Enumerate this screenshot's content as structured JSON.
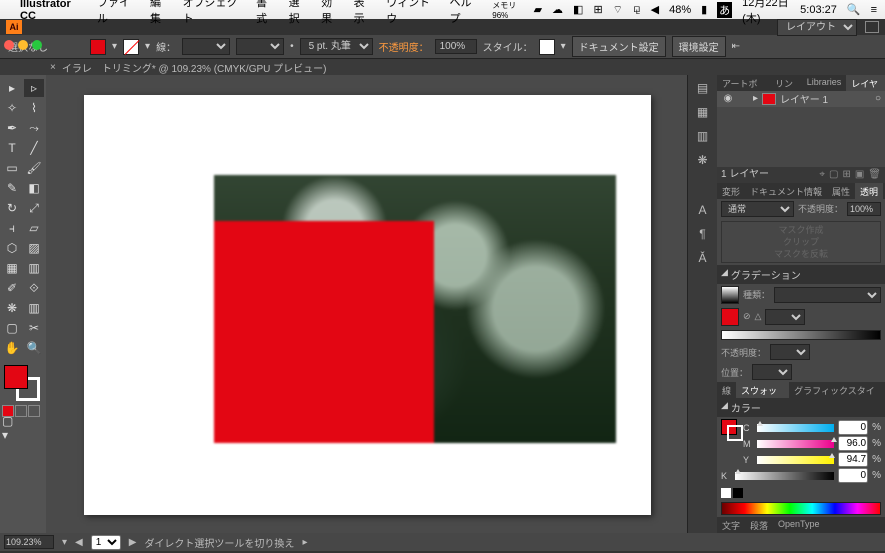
{
  "menubar": {
    "app": "Illustrator CC",
    "items": [
      "ファイル",
      "編集",
      "オブジェクト",
      "書式",
      "選択",
      "効果",
      "表示",
      "ウィンドウ",
      "ヘルプ"
    ],
    "right": {
      "mem": "メモリ 96%",
      "battery": "48%",
      "date": "12月22日(木)",
      "time": "5:03:27"
    }
  },
  "appbar": {
    "layout": "レイアウト"
  },
  "control": {
    "selection": "選択なし",
    "stroke": "線：",
    "strokeUnit": "5 pt. 丸筆",
    "opacity_label": "不透明度：",
    "opacity": "100%",
    "style": "スタイル：",
    "docsetup": "ドキュメント設定",
    "prefs": "環境設定"
  },
  "tab": {
    "close": "×",
    "title": "イラレ　トリミング* @ 109.23% (CMYK/GPU プレビュー)"
  },
  "layers": {
    "tabs": [
      "アートボード",
      "リンク",
      "Libraries",
      "レイヤー"
    ],
    "row": "レイヤー 1",
    "status": "1 レイヤー"
  },
  "appearance": {
    "tabs": [
      "変形",
      "ドキュメント情報",
      "属性",
      "透明"
    ],
    "blend": "通常",
    "op_label": "不透明度：",
    "op": "100%",
    "mask": [
      "マスク作成",
      "クリップ",
      "マスクを反転"
    ]
  },
  "gradient": {
    "head": "グラデーション",
    "type": "種類：",
    "angle": "△",
    "op": "不透明度：",
    "pos": "位置："
  },
  "swatches": {
    "tabs": [
      "線",
      "スウォッチ",
      "グラフィックスタイル"
    ],
    "head": "カラー"
  },
  "cmyk": {
    "c": {
      "l": "C",
      "v": "0"
    },
    "m": {
      "l": "M",
      "v": "96.0"
    },
    "y": {
      "l": "Y",
      "v": "94.7"
    },
    "k": {
      "l": "K",
      "v": "0"
    },
    "pct": "%"
  },
  "bottomtabs": [
    "文字",
    "段落",
    "OpenType"
  ],
  "status": {
    "zoom": "109.23%",
    "tool": "ダイレクト選択ツールを切り換え"
  }
}
